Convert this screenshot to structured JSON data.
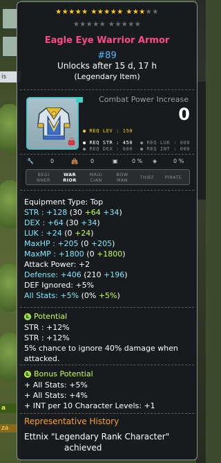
{
  "item": {
    "stars_row1_filled": 13,
    "stars_row1_total": 15,
    "stars_row2_filled": 0,
    "stars_row2_total": 10,
    "name": "Eagle Eye Warrior Armor",
    "rank": "#89",
    "unlock": "Unlocks after 15 d, 17 h",
    "grade": "(Legendary Item)",
    "combat_power_label": "Combat Power Increase",
    "combat_power_value": "0"
  },
  "requirements": {
    "lev": "REQ LEV : 150",
    "str": "REQ STR : 450",
    "dex": "REQ DEX : 000",
    "luk": "REQ LUK : 000",
    "int": "REQ INT : 000"
  },
  "mini": {
    "a": "0",
    "b": "0",
    "c": "0 %",
    "d": "0 %"
  },
  "classes": [
    {
      "label": "BEGI\nNNER",
      "active": false
    },
    {
      "label": "WAR\nRIOR",
      "active": true
    },
    {
      "label": "MAGI\nCIAN",
      "active": false
    },
    {
      "label": "BOW\nMAN",
      "active": false
    },
    {
      "label": "THIEF",
      "active": false
    },
    {
      "label": "PIRATE",
      "active": false
    }
  ],
  "stats": {
    "equipment_type": "Equipment Type: Top",
    "str": {
      "label": "STR : +128",
      "open": " (30 ",
      "bonus": "+64",
      "enh": " +34",
      "close": ")"
    },
    "dex": {
      "label": "DEX : +64",
      "open": " (30 ",
      "enh": "+34",
      "close": ")"
    },
    "luk": {
      "label": "LUK : +24",
      "open": " (0 ",
      "bonus": "+24",
      "close": ")"
    },
    "maxhp": {
      "label": "MaxHP : +205",
      "open": " (0 ",
      "enh": "+205",
      "close": ")"
    },
    "maxmp": {
      "label": "MaxMP : +1800",
      "open": " (0 ",
      "bonus": "+1800",
      "close": ")"
    },
    "attack": "Attack Power: +2",
    "defense": {
      "label": "Defense: +406",
      "open": " (210 ",
      "enh": "+196",
      "close": ")"
    },
    "def_ignored": "DEF Ignored: +5%",
    "all_stats": {
      "label": "All Stats: +5%",
      "open": " (0% ",
      "bonus": "+5%",
      "close": ")"
    }
  },
  "potential": {
    "title": "Potential",
    "icon_letter": "L",
    "lines": [
      "STR : +12%",
      "STR : +12%",
      "5% chance to ignore 40% damage when",
      "attacked."
    ]
  },
  "bonus_potential": {
    "title": "Bonus Potential",
    "icon_letter": "L",
    "lines": [
      "+ All Stats: +5%",
      "+ All Stats: +4%",
      "+ INT per 10 Character Levels: +1"
    ]
  },
  "history": {
    "title": "Representative History",
    "line1": "Ettnix  \"Legendary Rank Character\"",
    "line2": "achieved"
  },
  "background": {
    "tab_label": "is",
    "tag1": "a",
    "tag2": "za"
  },
  "colors": {
    "name": "#ff4a86",
    "rank": "#4fb9ff",
    "bonus_green": "#c6ff4a",
    "enhance_cyan": "#7fe9ff",
    "history_orange": "#ff9f2e",
    "border_teal": "#4ec3c7"
  }
}
